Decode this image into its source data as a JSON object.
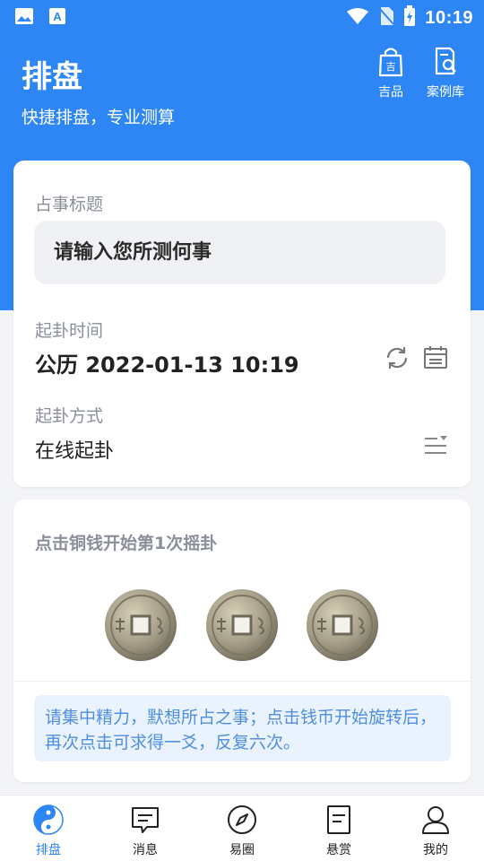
{
  "status_bar": {
    "time": "10:19",
    "left_icons": [
      "image-icon",
      "text-app-icon"
    ],
    "right_icons": [
      "wifi-icon",
      "no-sim-icon",
      "battery-charging-icon"
    ]
  },
  "header": {
    "title": "排盘",
    "subtitle": "快捷排盘，专业测算",
    "actions": [
      {
        "icon": "shopping-bag-icon",
        "label": "吉品"
      },
      {
        "icon": "case-search-icon",
        "label": "案例库"
      }
    ]
  },
  "form": {
    "title_label": "占事标题",
    "title_placeholder": "请输入您所测何事",
    "title_value": "",
    "time_label": "起卦时间",
    "time_value": "公历 2022-01-13 10:19",
    "method_label": "起卦方式",
    "method_value": "在线起卦"
  },
  "shake": {
    "hint": "点击铜钱开始第1次摇卦",
    "coins": [
      "coin-1",
      "coin-2",
      "coin-3"
    ],
    "tip": "请集中精力，默想所占之事；点击钱币开始旋转后，再次点击可求得一爻，反复六次。"
  },
  "tabs": [
    {
      "label": "排盘",
      "icon": "yin-yang-icon",
      "active": true
    },
    {
      "label": "消息",
      "icon": "message-icon",
      "active": false
    },
    {
      "label": "易圈",
      "icon": "compass-icon",
      "active": false
    },
    {
      "label": "悬赏",
      "icon": "document-icon",
      "active": false
    },
    {
      "label": "我的",
      "icon": "user-icon",
      "active": false
    }
  ],
  "colors": {
    "primary": "#2e86f4",
    "tip_background": "#eaf3fd",
    "tip_text": "#4f8fe0",
    "label_gray": "#8a8f99"
  }
}
